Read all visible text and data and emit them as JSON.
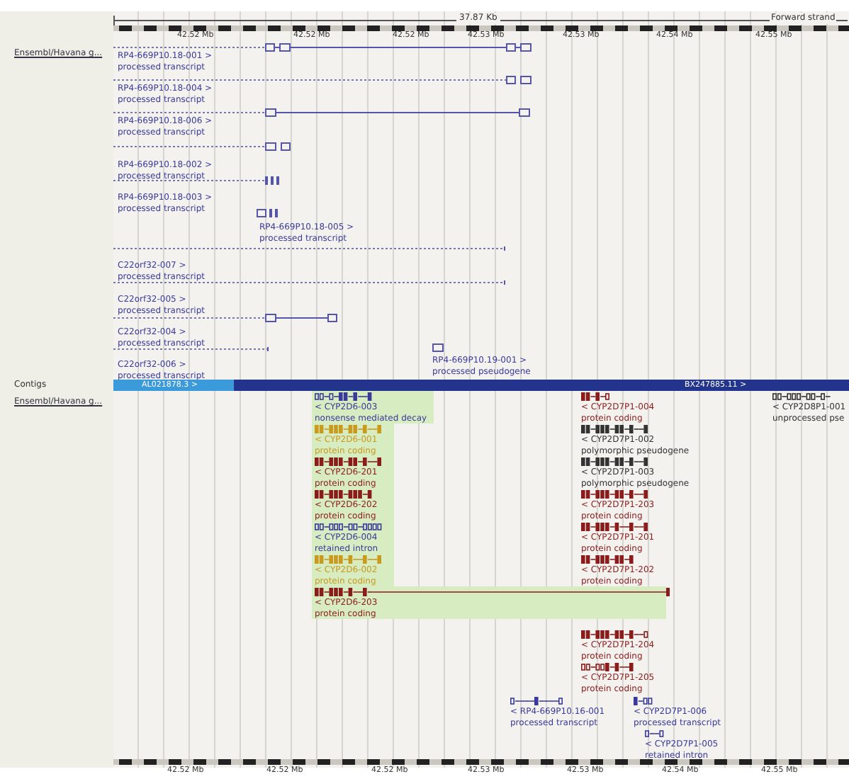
{
  "ruler": {
    "span": "37.87 Kb",
    "strand": "Forward strand",
    "ticks": [
      "42.52 Mb",
      "42.52 Mb",
      "42.52 Mb",
      "42.53 Mb",
      "42.53 Mb",
      "42.54 Mb",
      "42.55 Mb"
    ]
  },
  "track_labels": [
    {
      "label": "Ensembl/Havana g..."
    },
    {
      "label": "Contigs"
    },
    {
      "label": "Ensembl/Havana g..."
    }
  ],
  "forward_transcripts": [
    {
      "name": "RP4-669P10.18-001 >",
      "biotype": "processed transcript"
    },
    {
      "name": "RP4-669P10.18-004 >",
      "biotype": "processed transcript"
    },
    {
      "name": "RP4-669P10.18-006 >",
      "biotype": "processed transcript"
    },
    {
      "name": "RP4-669P10.18-002 >",
      "biotype": "processed transcript"
    },
    {
      "name": "RP4-669P10.18-003 >",
      "biotype": "processed transcript"
    },
    {
      "name": "RP4-669P10.18-005 >",
      "biotype": "processed transcript"
    },
    {
      "name": "C22orf32-007 >",
      "biotype": "processed transcript"
    },
    {
      "name": "C22orf32-005 >",
      "biotype": "processed transcript"
    },
    {
      "name": "C22orf32-004 >",
      "biotype": "processed transcript"
    },
    {
      "name": "C22orf32-006 >",
      "biotype": "processed transcript"
    },
    {
      "name": "RP4-669P10.19-001 >",
      "biotype": "processed pseudogene"
    }
  ],
  "contigs": [
    {
      "name": "AL021878.3 >",
      "color": "#3b9ad9"
    },
    {
      "name": "BX247885.11 >",
      "color": "#23348c"
    }
  ],
  "reverse_transcripts": [
    {
      "name": "< CYP2D6-003",
      "biotype": "nonsense mediated decay",
      "color": "#3a3a9a",
      "highlighted": true
    },
    {
      "name": "< CYP2D6-001",
      "biotype": "protein coding",
      "color": "#c99a1e",
      "highlighted": true
    },
    {
      "name": "< CYP2D6-201",
      "biotype": "protein coding",
      "color": "#8a1c1c",
      "highlighted": true
    },
    {
      "name": "< CYP2D6-202",
      "biotype": "protein coding",
      "color": "#8a1c1c",
      "highlighted": true
    },
    {
      "name": "< CYP2D6-004",
      "biotype": "retained intron",
      "color": "#3a3a9a",
      "highlighted": true
    },
    {
      "name": "< CYP2D6-002",
      "biotype": "protein coding",
      "color": "#c99a1e",
      "highlighted": true
    },
    {
      "name": "< CYP2D6-203",
      "biotype": "protein coding",
      "color": "#8a1c1c",
      "highlighted": true
    },
    {
      "name": "< CYP2D7P1-004",
      "biotype": "protein coding",
      "color": "#8a1c1c",
      "highlighted": false
    },
    {
      "name": "< CYP2D7P1-002",
      "biotype": "polymorphic pseudogene",
      "color": "#333333",
      "highlighted": false
    },
    {
      "name": "< CYP2D7P1-003",
      "biotype": "polymorphic pseudogene",
      "color": "#333333",
      "highlighted": false
    },
    {
      "name": "< CYP2D7P1-203",
      "biotype": "protein coding",
      "color": "#8a1c1c",
      "highlighted": false
    },
    {
      "name": "< CYP2D7P1-201",
      "biotype": "protein coding",
      "color": "#8a1c1c",
      "highlighted": false
    },
    {
      "name": "< CYP2D7P1-202",
      "biotype": "protein coding",
      "color": "#8a1c1c",
      "highlighted": false
    },
    {
      "name": "< CYP2D7P1-204",
      "biotype": "protein coding",
      "color": "#8a1c1c",
      "highlighted": false
    },
    {
      "name": "< CYP2D7P1-205",
      "biotype": "protein coding",
      "color": "#8a1c1c",
      "highlighted": false
    },
    {
      "name": "< CYP2D8P1-001",
      "biotype": "unprocessed pse",
      "color": "#333333",
      "highlighted": false
    },
    {
      "name": "< RP4-669P10.16-001",
      "biotype": "processed transcript",
      "color": "#3a3a9a",
      "highlighted": false
    },
    {
      "name": "< CYP2D7P1-006",
      "biotype": "processed transcript",
      "color": "#3a3a9a",
      "highlighted": false
    },
    {
      "name": "< CYP2D7P1-005",
      "biotype": "retained intron",
      "color": "#3a3a9a",
      "highlighted": false
    }
  ],
  "bottom_ruler": {
    "ticks": [
      "42.52 Mb",
      "42.52 Mb",
      "42.52 Mb",
      "42.53 Mb",
      "42.53 Mb",
      "42.54 Mb",
      "42.55 Mb"
    ]
  }
}
